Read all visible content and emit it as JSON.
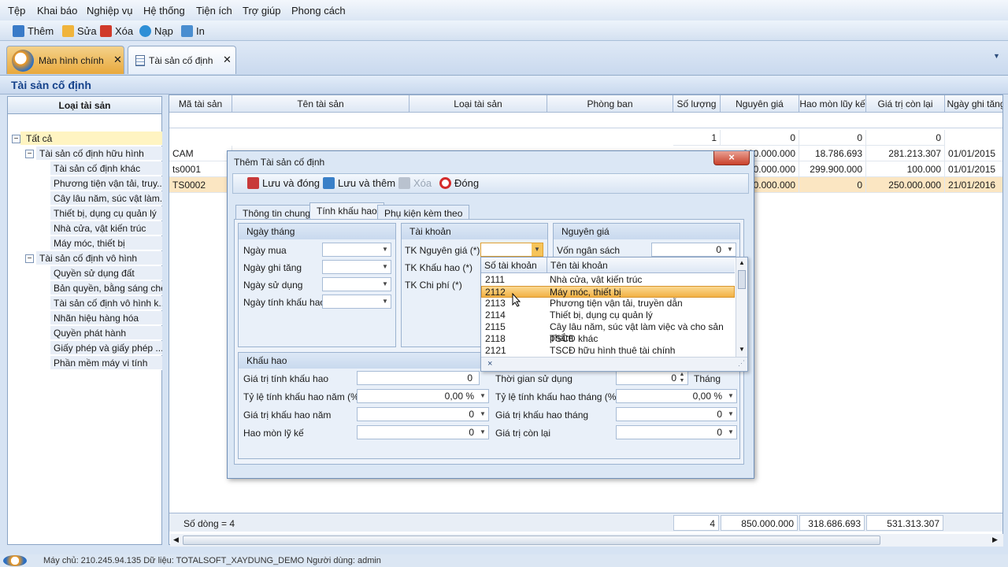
{
  "menu": [
    "Tệp",
    "Khai báo",
    "Nghiệp vụ",
    "Hệ thống",
    "Tiện ích",
    "Trợ giúp",
    "Phong cách"
  ],
  "toolbar": {
    "add": "Thêm",
    "edit": "Sửa",
    "delete": "Xóa",
    "reload": "Nạp",
    "print": "In"
  },
  "tabs": {
    "main": "Màn hình chính",
    "assets": "Tài sản cố định"
  },
  "page_title": "Tài sản cố định",
  "left_panel": {
    "header": "Loại tài sản",
    "root": "Tất cả",
    "groups": [
      {
        "label": "Tài sản cố định hữu hình",
        "children": [
          "Tài sản cố định khác",
          "Phương tiện vận tải, truy...",
          "Cây lâu năm, súc vật làm...",
          "Thiết bị, dụng cụ quản lý",
          "Nhà cửa, vật kiến trúc",
          "Máy móc, thiết bị"
        ]
      },
      {
        "label": "Tài sản cố định vô hình",
        "children": [
          "Quyền sử dụng đất",
          "Bản quyền, bằng sáng chế",
          "Tài sản cố định vô hình k...",
          "Nhãn hiệu hàng hóa",
          "Quyền phát hành",
          "Giấy phép và giấy phép ...",
          "Phần mềm máy vi tính"
        ]
      }
    ]
  },
  "grid": {
    "columns": [
      "Mã tài sản",
      "Tên tài sản",
      "Loại tài sản",
      "Phòng ban",
      "Số lượng",
      "Nguyên giá",
      "Hao mòn lũy kế",
      "Giá trị còn lại",
      "Ngày ghi tăng"
    ],
    "summary_row": [
      "1",
      "0",
      "0",
      "0"
    ],
    "rows": [
      {
        "code": "CAM",
        "cost": "300.000.000",
        "dep": "18.786.693",
        "remain": "281.213.307",
        "date": "01/01/2015"
      },
      {
        "code": "ts0001",
        "cost": "300.000.000",
        "dep": "299.900.000",
        "remain": "100.000",
        "date": "01/01/2015"
      },
      {
        "code": "TS0002",
        "cost": "250.000.000",
        "dep": "0",
        "remain": "250.000.000",
        "date": "21/01/2016"
      }
    ],
    "footer": {
      "row_count": "Số dòng = 4",
      "qty": "4",
      "cost": "850.000.000",
      "dep": "318.686.693",
      "remain": "531.313.307"
    }
  },
  "dialog": {
    "title": "Thêm Tài sản cố định",
    "close": "×",
    "toolbar": {
      "save_close": "Lưu và đóng",
      "save_add": "Lưu và thêm",
      "delete": "Xóa",
      "close": "Đóng"
    },
    "tabs": [
      "Thông tin chung",
      "Tính khấu hao",
      "Phụ kiện kèm theo"
    ],
    "dates": {
      "header": "Ngày tháng",
      "buy": "Ngày mua",
      "record": "Ngày ghi tăng",
      "use": "Ngày sử dụng",
      "dep": "Ngày tính khấu hao"
    },
    "accounts": {
      "header": "Tài khoản",
      "cost": "TK Nguyên giá (*)",
      "dep": "TK Khấu hao (*)",
      "expense": "TK Chi phí (*)"
    },
    "cost": {
      "header": "Nguyên giá",
      "budget": "Vốn ngân sách",
      "budget_value": "0"
    },
    "depreciation": {
      "header": "Khấu hao",
      "value_label": "Giá trị tính khấu hao",
      "value": "0",
      "rate_year_label": "Tỷ lệ tính khấu hao năm (%)",
      "rate_year": "0,00 %",
      "year_value_label": "Giá trị khấu hao năm",
      "year_value": "0",
      "accum_label": "Hao mòn lỹ kế",
      "accum": "0",
      "period_label": "Thời gian sử dụng",
      "period": "0",
      "period_unit": "Tháng",
      "rate_month_label": "Tỷ lệ tính khấu hao tháng (%)",
      "rate_month": "0,00 %",
      "month_value_label": "Giá trị khấu hao tháng",
      "month_value": "0",
      "remain_label": "Giá trị còn lại",
      "remain": "0"
    }
  },
  "dropdown": {
    "col_code": "Số tài khoản",
    "col_name": "Tên tài khoản",
    "items": [
      {
        "code": "2111",
        "name": "Nhà cửa, vật kiến trúc"
      },
      {
        "code": "2112",
        "name": "Máy móc, thiết bị"
      },
      {
        "code": "2113",
        "name": "Phương tiện vận tải, truyền dẫn"
      },
      {
        "code": "2114",
        "name": "Thiết bị, dụng cụ quản lý"
      },
      {
        "code": "2115",
        "name": "Cây lâu năm, súc vật làm việc và cho sản phẩm"
      },
      {
        "code": "2118",
        "name": "TSCĐ khác"
      },
      {
        "code": "2121",
        "name": "TSCĐ hữu hình thuê tài chính"
      }
    ],
    "clear": "×"
  },
  "status": "Máy chủ: 210.245.94.135    Dữ liệu: TOTALSOFT_XAYDUNG_DEMO    Người dùng: admin"
}
